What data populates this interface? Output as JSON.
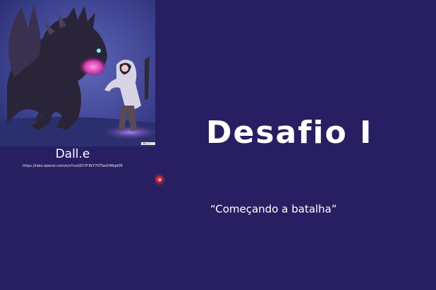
{
  "slide": {
    "image_caption": "Dall.e",
    "image_source_url": "https://labs.openai.com/e/xYvsdZh7P3kY7OTbeD4Rqd06",
    "title": "Desafio I",
    "subtitle": "“Começando a batalha”",
    "background_color": "#281f62",
    "text_color": "#ffffff",
    "image_icon": "dragon-vs-hooded-warrior-illustration",
    "pointer_icon": "laser-pointer-dot"
  }
}
